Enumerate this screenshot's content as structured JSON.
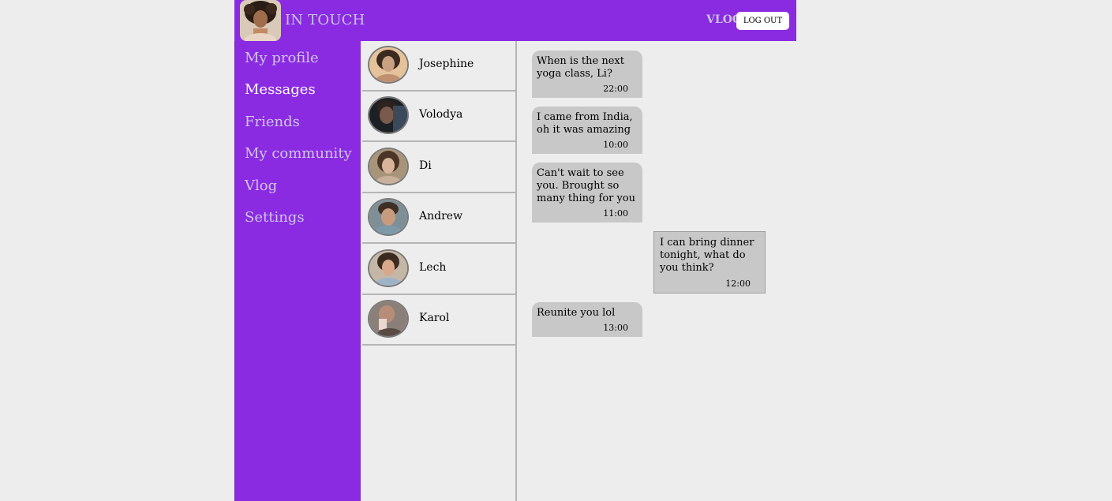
{
  "header": {
    "brand": "IN TOUCH",
    "vlog_link": "VLOG",
    "logout_label": "LOG OUT"
  },
  "sidebar": {
    "items": [
      {
        "label": "My profile"
      },
      {
        "label": "Messages",
        "active": true
      },
      {
        "label": "Friends"
      },
      {
        "label": "My community"
      },
      {
        "label": "Vlog"
      },
      {
        "label": "Settings"
      }
    ]
  },
  "contacts": [
    {
      "name": "Josephine"
    },
    {
      "name": "Volodya"
    },
    {
      "name": "Di"
    },
    {
      "name": "Andrew"
    },
    {
      "name": "Lech"
    },
    {
      "name": "Karol"
    }
  ],
  "messages": [
    {
      "text": "When is the next yoga class, Li?",
      "time": "22:00",
      "side": "left"
    },
    {
      "text": "I came from India, oh it was amazing",
      "time": "10:00",
      "side": "left"
    },
    {
      "text": "Can't wait to see you. Brought so many thing for you",
      "time": "11:00",
      "side": "left"
    },
    {
      "text": "I can bring dinner tonight, what do you think?",
      "time": "12:00",
      "side": "right"
    },
    {
      "text": "Reunite you lol",
      "time": "13:00",
      "side": "left"
    }
  ],
  "colors": {
    "accent": "#8a2be2",
    "page_background": "#ededed",
    "bubble": "#c8c8c8"
  }
}
